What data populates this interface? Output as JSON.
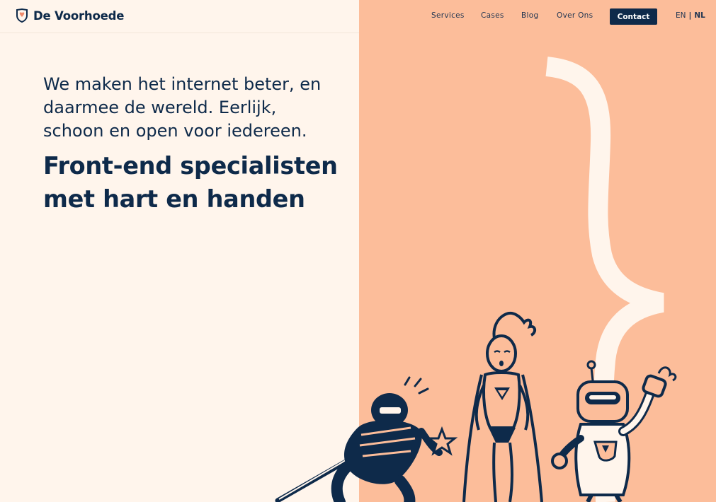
{
  "header": {
    "brand": "De Voorhoede",
    "nav": [
      "Services",
      "Cases",
      "Blog",
      "Over Ons"
    ],
    "contact_label": "Contact",
    "lang": {
      "en": "EN",
      "sep": "|",
      "nl": "NL",
      "active": "NL"
    }
  },
  "hero": {
    "intro": "We maken het internet beter, en daarmee de wereld. Eerlijk, schoon en open voor iedereen.",
    "headline": "Front-end specialisten met hart en handen"
  },
  "icons": {
    "logo": "shield-heart-icon",
    "decoration": "curly-brace-icon"
  },
  "colors": {
    "navy": "#0e2a4a",
    "cream": "#fff5ec",
    "peach": "#fcbd9a"
  }
}
